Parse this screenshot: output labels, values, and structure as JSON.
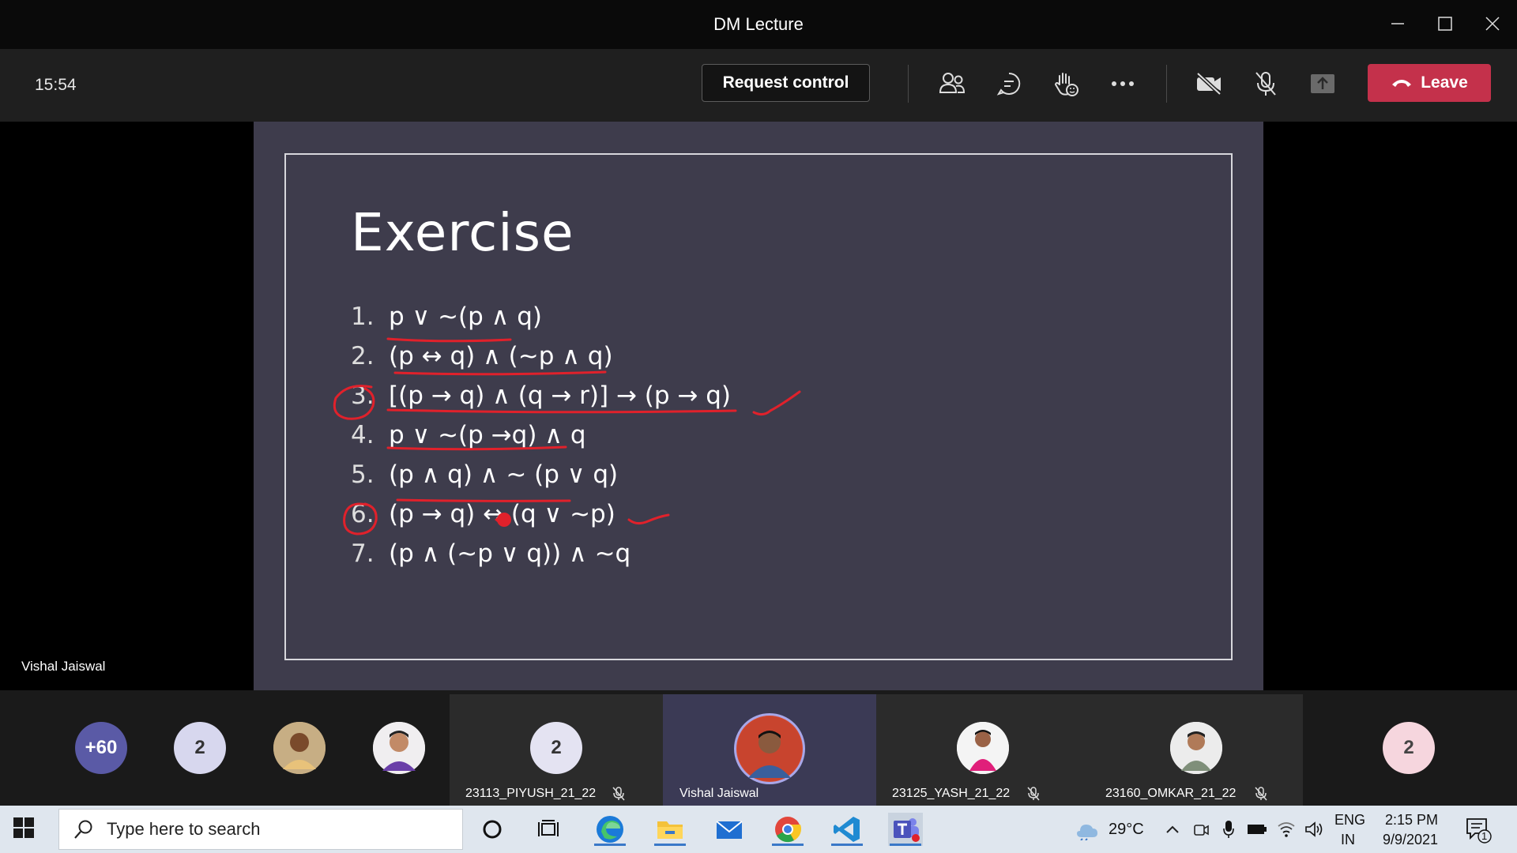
{
  "window": {
    "title": "DM Lecture"
  },
  "toolbar": {
    "time": "15:54",
    "request_control_label": "Request control",
    "leave_label": "Leave"
  },
  "slide": {
    "title": "Exercise",
    "items": [
      {
        "num": "1.",
        "text": "p ∨ ~(p ∧ q)"
      },
      {
        "num": "2.",
        "text": "(p ↔ q) ∧ (~p ∧ q)"
      },
      {
        "num": "3.",
        "text": "[(p → q) ∧ (q → r)] → (p → q)"
      },
      {
        "num": "4.",
        "text": "p ∨ ~(p →q) ∧ q"
      },
      {
        "num": "5.",
        "text": "(p ∧ q) ∧ ~ (p ∨ q)"
      },
      {
        "num": "6.",
        "text": "(p → q) ↔ (q ∨ ~p)"
      },
      {
        "num": "7.",
        "text": "(p ∧ (~p ∨ q)) ∧ ~q"
      }
    ]
  },
  "presenter": {
    "name": "Vishal Jaiswal"
  },
  "participants": {
    "overflow_count": "+60",
    "count_a": "2",
    "tiles": [
      {
        "name": "23113_PIYUSH_21_22",
        "initials": "2"
      },
      {
        "name": "Vishal Jaiswal"
      },
      {
        "name": "23125_YASH_21_22"
      },
      {
        "name": "23160_OMKAR_21_22"
      }
    ],
    "count_b": "2"
  },
  "taskbar": {
    "search_placeholder": "Type here to search",
    "weather": "29°C",
    "lang_top": "ENG",
    "lang_bottom": "IN",
    "time": "2:15 PM",
    "date": "9/9/2021",
    "notification_count": "1"
  },
  "colors": {
    "leave": "#c4314b",
    "slide_bg": "#3e3c4c",
    "annotation": "#e0212b",
    "active_tile": "#3b3a55"
  }
}
